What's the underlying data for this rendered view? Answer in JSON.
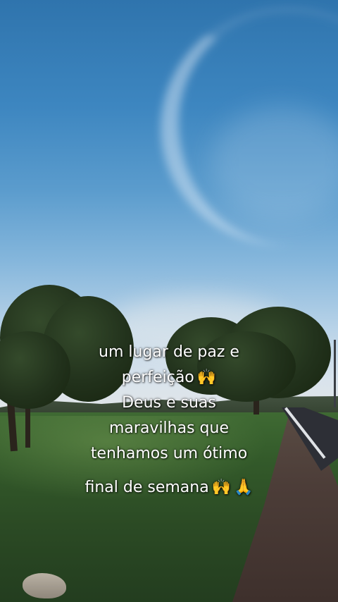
{
  "caption": {
    "line1": "um lugar de paz e",
    "line2": "perfeição",
    "line3": "Deus e suas",
    "line4": "maravilhas que",
    "line5": "tenhamos um ótimo",
    "line6": "final de semana",
    "emoji_raising_hands": "🙌",
    "emoji_folded_hands": "🙏"
  }
}
